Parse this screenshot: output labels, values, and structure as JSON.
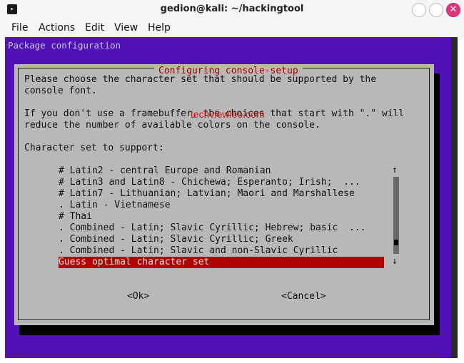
{
  "window": {
    "title": "gedion@kali: ~/hackingtool",
    "close_symbol": "✕",
    "terminal_icon_glyph": "▸"
  },
  "menu": [
    "File",
    "Actions",
    "Edit",
    "View",
    "Help"
  ],
  "terminal": {
    "header": "Package configuration"
  },
  "dialog": {
    "title": "Configuring console-setup",
    "paragraph1": [
      "Please choose the character set that should be supported by the",
      "console font."
    ],
    "paragraph2": [
      "If you don't use a framebuffer, the choices that start with \".\" will",
      "reduce the number of available colors on the console."
    ],
    "prompt": "Character set to support:",
    "options": [
      "# Latin2 - central Europe and Romanian",
      "# Latin3 and Latin8 - Chichewa; Esperanto; Irish;  ...",
      "# Latin7 - Lithuanian; Latvian; Maori and Marshallese",
      ". Latin - Vietnamese",
      "# Thai",
      ". Combined - Latin; Slavic Cyrillic; Hebrew; basic  ...",
      ". Combined - Latin; Slavic Cyrillic; Greek",
      ". Combined - Latin; Slavic and non-Slavic Cyrillic",
      "Guess optimal character set"
    ],
    "selected_index": 8,
    "ok_label": "<Ok>",
    "cancel_label": "<Cancel>",
    "scroll_up": "↑",
    "scroll_down": "↓"
  },
  "watermark": "techviewleo.com",
  "colors": {
    "terminal_bg": "#5111b6",
    "dialog_bg": "#b8b8b8",
    "selection": "#b30000",
    "dialog_title": "#a00000"
  }
}
